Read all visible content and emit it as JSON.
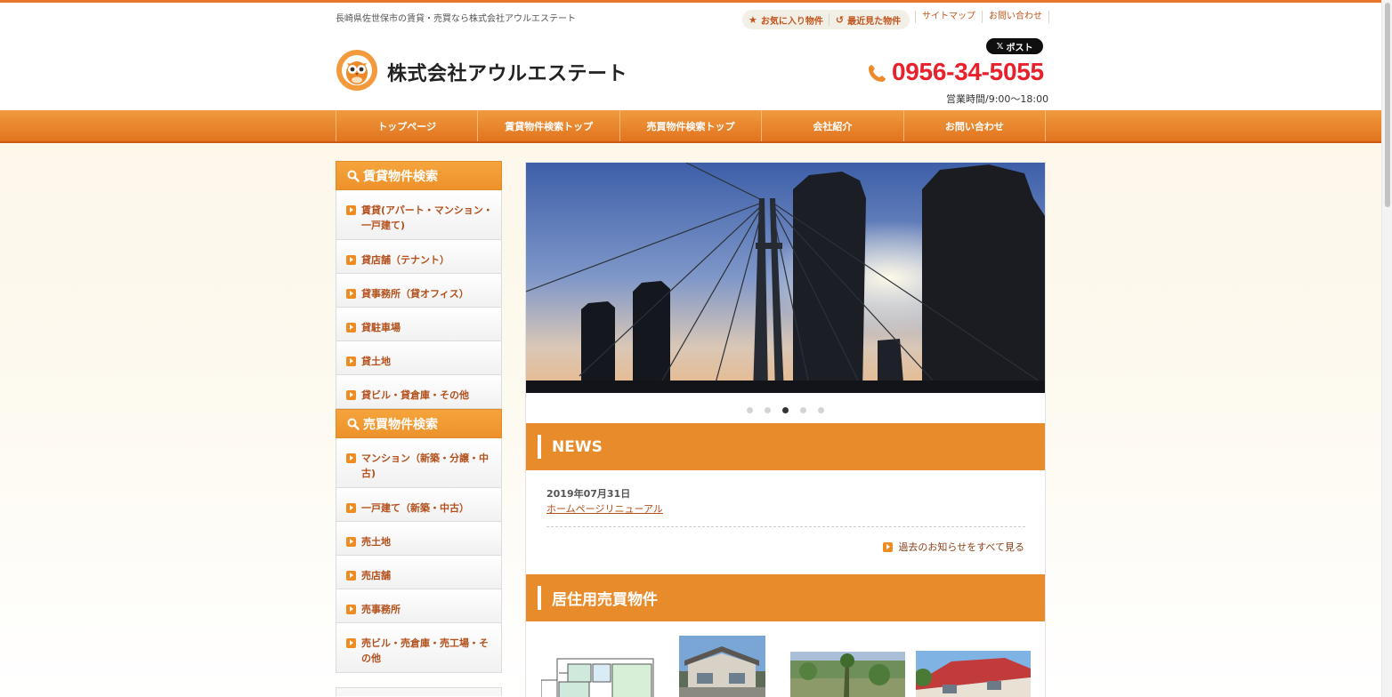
{
  "header": {
    "tagline": "長崎県佐世保市の賃貸・売買なら株式会社アウルエステート",
    "favorites_label": "お気に入り物件",
    "recent_label": "最近見た物件",
    "util_links": [
      "サイトマップ",
      "お問い合わせ"
    ],
    "x_post_label": "ポスト",
    "company_name": "株式会社アウルエステート",
    "logo_ring_text": "OWL ESTATE",
    "phone": "0956-34-5055",
    "hours": "営業時間/9:00〜18:00"
  },
  "nav": {
    "items": [
      "トップページ",
      "賃貸物件検索トップ",
      "売買物件検索トップ",
      "会社紹介",
      "お問い合わせ"
    ]
  },
  "sidebar": {
    "rent_heading": "賃貸物件検索",
    "rent_items": [
      "賃貸(アパート・マンション・一戸建て)",
      "貸店舗（テナント）",
      "貸事務所（貸オフィス）",
      "貸駐車場",
      "貸土地",
      "貸ビル・貸倉庫・その他"
    ],
    "sale_heading": "売買物件検索",
    "sale_items": [
      "マンション（新築・分譲・中古)",
      "一戸建て（新築・中古）",
      "売土地",
      "売店舗",
      "売事務所",
      "売ビル・売倉庫・売工場・その他"
    ]
  },
  "slider": {
    "dot_count": 5,
    "active_index": 3
  },
  "news": {
    "heading": "NEWS",
    "date": "2019年07月31日",
    "title": "ホームページリニューアル",
    "more_label": "過去のお知らせをすべて見る"
  },
  "residential": {
    "heading": "居住用売買物件"
  },
  "colors": {
    "accent": "#e88c2b",
    "phone": "#e8222c",
    "link": "#b3501c"
  }
}
